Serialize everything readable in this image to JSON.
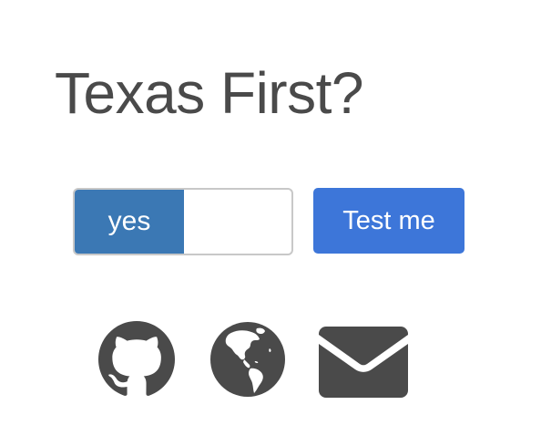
{
  "header": {
    "title": "Texas First?"
  },
  "controls": {
    "toggle_label": "yes",
    "toggle_state": true,
    "test_button_label": "Test me"
  },
  "social_links": [
    {
      "icon": "github-icon"
    },
    {
      "icon": "globe-icon"
    },
    {
      "icon": "mail-icon"
    }
  ],
  "colors": {
    "toggle_on": "#3b78b4",
    "button": "#3d76d9",
    "text": "#4a4a4a",
    "icons": "#4a4a4a"
  }
}
